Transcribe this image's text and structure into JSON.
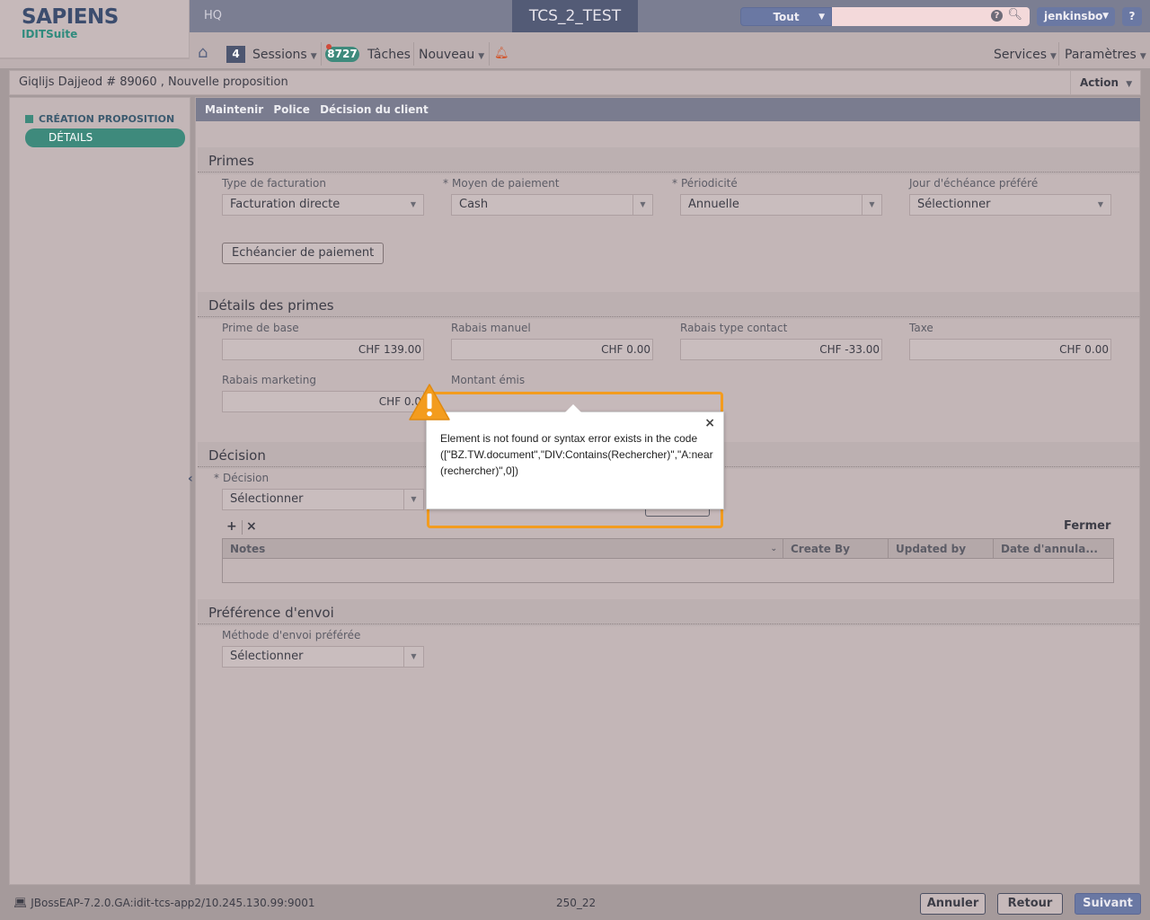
{
  "header": {
    "logo_main": "SAPIENS",
    "logo_sub": "IDITSuite",
    "hq": "HQ",
    "environment": "TCS_2_TEST",
    "search_scope": "Tout",
    "search_placeholder": "",
    "user": "jenkinsbo",
    "help": "?"
  },
  "nav": {
    "sessions_count": "4",
    "sessions_label": "Sessions",
    "tasks_count": "8727",
    "tasks_label": "Tâches",
    "new_label": "Nouveau",
    "services_label": "Services",
    "settings_label": "Paramètres"
  },
  "policy": {
    "title": "Giqlijs Dajjeod # 89060 , Nouvelle proposition",
    "action_label": "Action"
  },
  "left_panel": {
    "section": "CRÉATION PROPOSITION",
    "active_item": "DÉTAILS"
  },
  "breadcrumb": [
    "Maintenir",
    "Police",
    "Décision du client"
  ],
  "primes": {
    "heading": "Primes",
    "billing_type_label": "Type de facturation",
    "billing_type_value": "Facturation directe",
    "payment_method_label": "Moyen de paiement",
    "payment_method_value": "Cash",
    "periodicity_label": "Périodicité",
    "periodicity_value": "Annuelle",
    "due_day_label": "Jour d'échéance préféré",
    "due_day_value": "Sélectionner",
    "schedule_button": "Echéancier de paiement",
    "required_mark": "*"
  },
  "premium_details": {
    "heading": "Détails des primes",
    "base_premium_label": "Prime de base",
    "base_premium_value": "CHF 139.00",
    "manual_discount_label": "Rabais manuel",
    "manual_discount_value": "CHF 0.00",
    "contact_discount_label": "Rabais type contact",
    "contact_discount_value": "CHF -33.00",
    "tax_label": "Taxe",
    "tax_value": "CHF 0.00",
    "marketing_discount_label": "Rabais marketing",
    "marketing_discount_value": "CHF 0.0",
    "issued_amount_label": "Montant émis"
  },
  "decision": {
    "heading": "Décision",
    "decision_label": "Décision",
    "decision_value": "Sélectionner",
    "add_icon": "+",
    "delete_icon": "×",
    "close_label": "Fermer",
    "columns": [
      "Notes",
      "Create By",
      "Updated by",
      "Date d'annula..."
    ]
  },
  "delivery": {
    "heading": "Préférence d'envoi",
    "method_label": "Méthode d'envoi préférée",
    "method_value": "Sélectionner"
  },
  "status": {
    "server": "JBossEAP-7.2.0.GA:idit-tcs-app2/10.245.130.99:9001",
    "build": "250_22"
  },
  "footer_buttons": {
    "cancel": "Annuler",
    "back": "Retour",
    "next": "Suivant"
  },
  "error": {
    "message": "Element is not found or syntax error exists in the code ([\"BZ.TW.document\",\"DIV:Contains(Rechercher)\",\"A:near(rechercher)\",0])",
    "close": "×"
  },
  "colors": {
    "accent": "#3e8a7c",
    "header": "#7b7e92",
    "primary_button": "#6a78a3",
    "warning": "#f39c1e"
  }
}
